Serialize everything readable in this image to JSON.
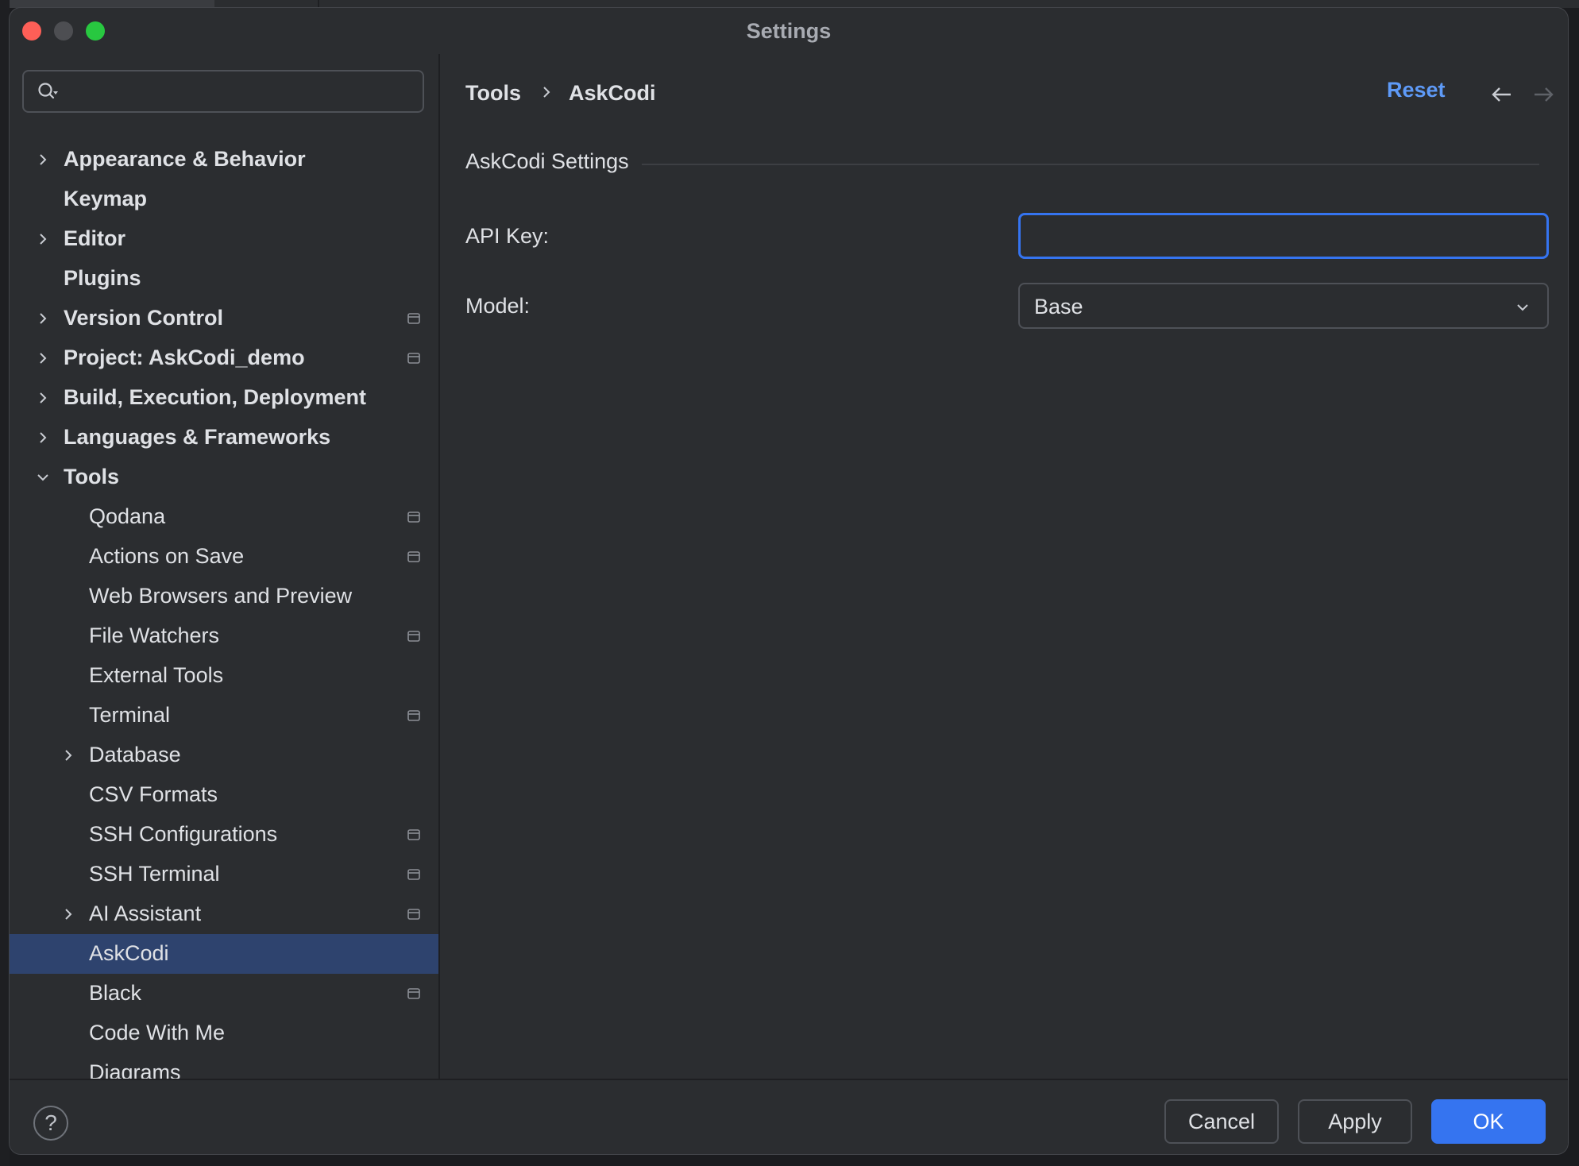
{
  "window": {
    "title": "Settings"
  },
  "search": {
    "placeholder": "",
    "value": ""
  },
  "sidebar": {
    "items": [
      {
        "label": "Appearance & Behavior",
        "level": 0,
        "expandable": true,
        "expanded": false,
        "bold": true,
        "project": false
      },
      {
        "label": "Keymap",
        "level": 0,
        "expandable": false,
        "bold": true,
        "project": false
      },
      {
        "label": "Editor",
        "level": 0,
        "expandable": true,
        "expanded": false,
        "bold": true,
        "project": false
      },
      {
        "label": "Plugins",
        "level": 0,
        "expandable": false,
        "bold": true,
        "project": false
      },
      {
        "label": "Version Control",
        "level": 0,
        "expandable": true,
        "expanded": false,
        "bold": true,
        "project": true
      },
      {
        "label": "Project: AskCodi_demo",
        "level": 0,
        "expandable": true,
        "expanded": false,
        "bold": true,
        "project": true
      },
      {
        "label": "Build, Execution, Deployment",
        "level": 0,
        "expandable": true,
        "expanded": false,
        "bold": true,
        "project": false
      },
      {
        "label": "Languages & Frameworks",
        "level": 0,
        "expandable": true,
        "expanded": false,
        "bold": true,
        "project": false
      },
      {
        "label": "Tools",
        "level": 0,
        "expandable": true,
        "expanded": true,
        "bold": true,
        "project": false
      },
      {
        "label": "Qodana",
        "level": 1,
        "expandable": false,
        "bold": false,
        "project": true
      },
      {
        "label": "Actions on Save",
        "level": 1,
        "expandable": false,
        "bold": false,
        "project": true
      },
      {
        "label": "Web Browsers and Preview",
        "level": 1,
        "expandable": false,
        "bold": false,
        "project": false
      },
      {
        "label": "File Watchers",
        "level": 1,
        "expandable": false,
        "bold": false,
        "project": true
      },
      {
        "label": "External Tools",
        "level": 1,
        "expandable": false,
        "bold": false,
        "project": false
      },
      {
        "label": "Terminal",
        "level": 1,
        "expandable": false,
        "bold": false,
        "project": true
      },
      {
        "label": "Database",
        "level": 1,
        "expandable": true,
        "expanded": false,
        "bold": false,
        "project": false
      },
      {
        "label": "CSV Formats",
        "level": 1,
        "expandable": false,
        "bold": false,
        "project": false
      },
      {
        "label": "SSH Configurations",
        "level": 1,
        "expandable": false,
        "bold": false,
        "project": true
      },
      {
        "label": "SSH Terminal",
        "level": 1,
        "expandable": false,
        "bold": false,
        "project": true
      },
      {
        "label": "AI Assistant",
        "level": 1,
        "expandable": true,
        "expanded": false,
        "bold": false,
        "project": true
      },
      {
        "label": "AskCodi",
        "level": 1,
        "expandable": false,
        "bold": false,
        "project": false,
        "selected": true
      },
      {
        "label": "Black",
        "level": 1,
        "expandable": false,
        "bold": false,
        "project": true
      },
      {
        "label": "Code With Me",
        "level": 1,
        "expandable": false,
        "bold": false,
        "project": false
      },
      {
        "label": "Diagrams",
        "level": 1,
        "expandable": false,
        "bold": false,
        "project": false
      }
    ]
  },
  "breadcrumb": {
    "parent": "Tools",
    "current": "AskCodi"
  },
  "header": {
    "reset_label": "Reset"
  },
  "settings": {
    "section_title": "AskCodi Settings",
    "api_key_label": "API Key:",
    "api_key_value": "",
    "model_label": "Model:",
    "model_value": "Base"
  },
  "footer": {
    "help_label": "?",
    "cancel_label": "Cancel",
    "apply_label": "Apply",
    "ok_label": "OK"
  },
  "colors": {
    "accent": "#3574f0",
    "link": "#5e9af7",
    "selection": "#2e436e",
    "background": "#2b2d30"
  }
}
